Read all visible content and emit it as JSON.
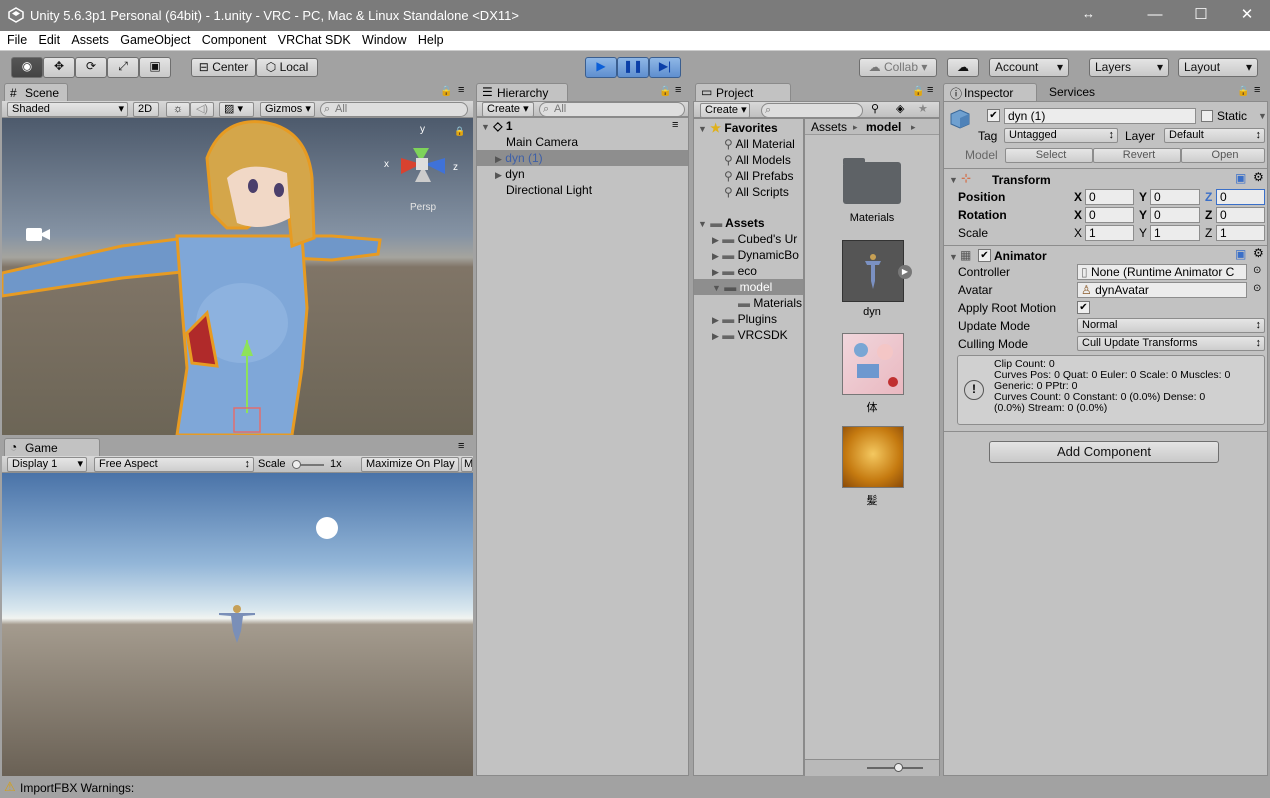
{
  "window": {
    "title": "Unity 5.6.3p1 Personal (64bit) - 1.unity - VRC - PC, Mac & Linux Standalone <DX11>"
  },
  "menu": [
    "File",
    "Edit",
    "Assets",
    "GameObject",
    "Component",
    "VRChat SDK",
    "Window",
    "Help"
  ],
  "toolbar": {
    "center": "Center",
    "local": "Local",
    "collab": "Collab",
    "account": "Account",
    "layers": "Layers",
    "layout": "Layout"
  },
  "scene": {
    "tab": "Scene",
    "shading": "Shaded",
    "mode2d": "2D",
    "gizmos": "Gizmos",
    "search_placeholder": "All",
    "persp": "Persp",
    "axis_x": "x",
    "axis_y": "y",
    "axis_z": "z"
  },
  "game": {
    "tab": "Game",
    "display": "Display 1",
    "aspect": "Free Aspect",
    "scale_label": "Scale",
    "scale_value": "1x",
    "maximize": "Maximize On Play",
    "more": "M"
  },
  "hierarchy": {
    "tab": "Hierarchy",
    "create": "Create",
    "search_placeholder": "All",
    "scene_name": "1",
    "items": [
      "Main Camera",
      "dyn (1)",
      "dyn",
      "Directional Light"
    ]
  },
  "project": {
    "tab": "Project",
    "create": "Create",
    "favorites_label": "Favorites",
    "favorites": [
      "All Material",
      "All Models",
      "All Prefabs",
      "All Scripts"
    ],
    "assets_label": "Assets",
    "folders": [
      "Cubed's Ur",
      "DynamicBo",
      "eco",
      "model",
      "Materials",
      "Plugins",
      "VRCSDK"
    ],
    "breadcrumb": [
      "Assets",
      "model"
    ],
    "grid": [
      "Materials",
      "dyn",
      "体",
      "髪"
    ]
  },
  "inspector": {
    "tab": "Inspector",
    "services": "Services",
    "object_name": "dyn (1)",
    "static": "Static",
    "tag_label": "Tag",
    "tag_value": "Untagged",
    "layer_label": "Layer",
    "layer_value": "Default",
    "model_label": "Model",
    "model_select": "Select",
    "model_revert": "Revert",
    "model_open": "Open",
    "transform": {
      "title": "Transform",
      "position": {
        "label": "Position",
        "x": "0",
        "y": "0",
        "z": "0"
      },
      "rotation": {
        "label": "Rotation",
        "x": "0",
        "y": "0",
        "z": "0"
      },
      "scale": {
        "label": "Scale",
        "x": "1",
        "y": "1",
        "z": "1"
      }
    },
    "animator": {
      "title": "Animator",
      "controller_label": "Controller",
      "controller_value": "None (Runtime Animator C",
      "avatar_label": "Avatar",
      "avatar_value": "dynAvatar",
      "root_motion_label": "Apply Root Motion",
      "update_label": "Update Mode",
      "update_value": "Normal",
      "culling_label": "Culling Mode",
      "culling_value": "Cull Update Transforms",
      "info": [
        "Clip Count: 0",
        "Curves Pos: 0 Quat: 0 Euler: 0 Scale: 0 Muscles: 0",
        "Generic: 0 PPtr: 0",
        "Curves Count: 0 Constant: 0 (0.0%) Dense: 0",
        "(0.0%) Stream: 0 (0.0%)"
      ]
    },
    "add_component": "Add Component"
  },
  "status": {
    "text": "ImportFBX Warnings:"
  },
  "axis_labels": {
    "x": "X",
    "y": "Y",
    "z": "Z"
  }
}
